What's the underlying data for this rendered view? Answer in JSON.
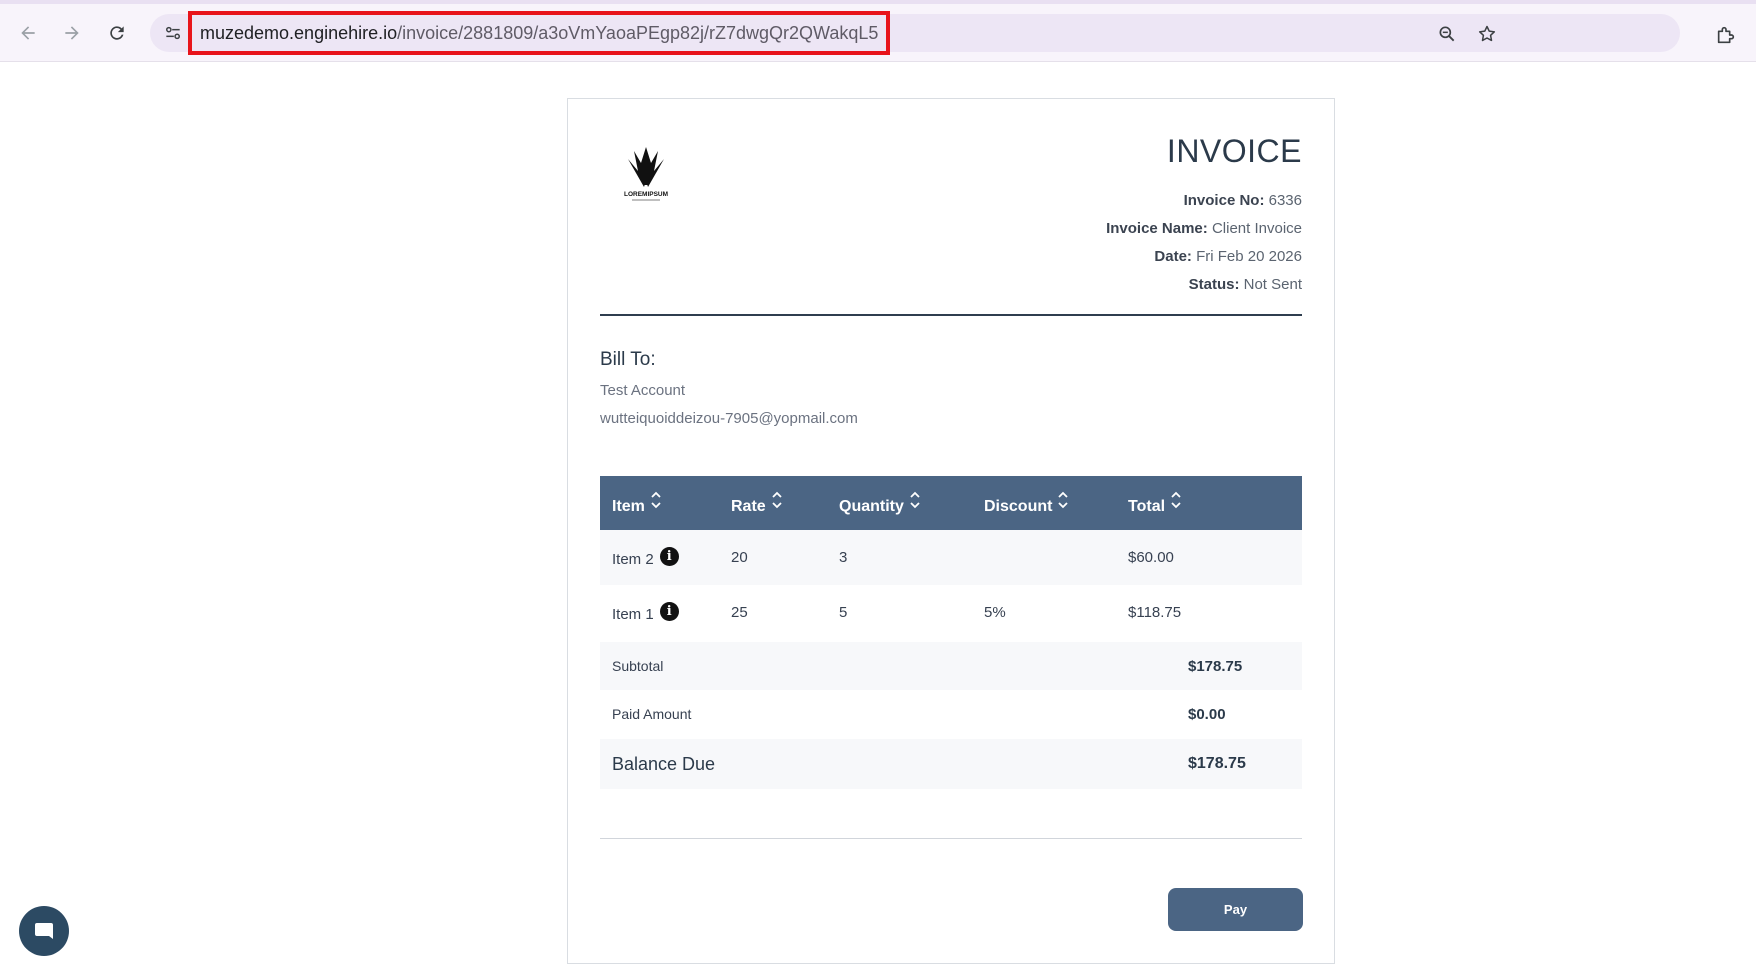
{
  "browser": {
    "url_host": "muzedemo.enginehire.io",
    "url_path": "/invoice/2881809/a3oVmYaoaPEgp82j/rZ7dwgQr2QWakqL5",
    "icons": [
      "back-icon",
      "forward-icon",
      "reload-icon",
      "site-info-icon",
      "zoom-icon",
      "bookmark-star-icon",
      "extensions-icon"
    ]
  },
  "invoice": {
    "title": "INVOICE",
    "number_label": "Invoice No:",
    "number": "6336",
    "name_label": "Invoice Name:",
    "name": "Client Invoice",
    "date_label": "Date:",
    "date": "Fri Feb 20 2026",
    "status_label": "Status:",
    "status": "Not Sent",
    "logo_text": "LOREMIPSUM"
  },
  "bill_to": {
    "heading": "Bill To:",
    "name": "Test Account",
    "email": "wutteiquoiddeizou-7905@yopmail.com"
  },
  "table": {
    "headers": [
      "Item",
      "Rate",
      "Quantity",
      "Discount",
      "Total"
    ],
    "rows": [
      {
        "item": "Item 2",
        "rate": "20",
        "quantity": "3",
        "discount": "",
        "total": "$60.00"
      },
      {
        "item": "Item 1",
        "rate": "25",
        "quantity": "5",
        "discount": "5%",
        "total": "$118.75"
      }
    ]
  },
  "summary": {
    "subtotal_label": "Subtotal",
    "subtotal": "$178.75",
    "paid_label": "Paid Amount",
    "paid": "$0.00",
    "balance_label": "Balance Due",
    "balance": "$178.75"
  },
  "actions": {
    "pay_label": "Pay"
  },
  "colors": {
    "header_bg": "#4b6584",
    "url_highlight": "#e8141b",
    "chat_bubble": "#2c4a63"
  }
}
